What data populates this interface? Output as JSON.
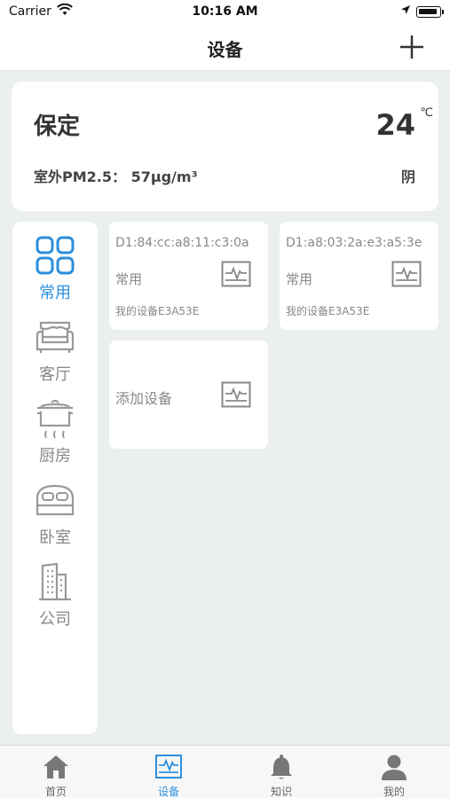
{
  "status_bar": {
    "carrier": "Carrier",
    "time": "10:16 AM"
  },
  "nav": {
    "title": "设备",
    "add_icon": "plus-icon"
  },
  "weather": {
    "city": "保定",
    "temperature": "24",
    "unit": "℃",
    "pm25": "室外PM2.5： 57μg/m³",
    "condition": "阴"
  },
  "rooms": [
    {
      "label": "常用",
      "icon": "grid-icon",
      "active": true
    },
    {
      "label": "客厅",
      "icon": "sofa-icon",
      "active": false
    },
    {
      "label": "厨房",
      "icon": "pot-icon",
      "active": false
    },
    {
      "label": "卧室",
      "icon": "bed-icon",
      "active": false
    },
    {
      "label": "公司",
      "icon": "building-icon",
      "active": false
    }
  ],
  "devices": [
    {
      "mac": "D1:84:cc:a8:11:c3:0a",
      "room": "常用",
      "name": "我的设备E3A53E",
      "icon": "monitor-icon"
    },
    {
      "mac": "D1:a8:03:2a:e3:a5:3e",
      "room": "常用",
      "name": "我的设备E3A53E",
      "icon": "monitor-icon"
    }
  ],
  "add_device": {
    "label": "添加设备",
    "icon": "monitor-icon"
  },
  "tabs": [
    {
      "label": "首页",
      "icon": "home-icon",
      "active": false
    },
    {
      "label": "设备",
      "icon": "device-icon",
      "active": true
    },
    {
      "label": "知识",
      "icon": "bell-icon",
      "active": false
    },
    {
      "label": "我的",
      "icon": "user-icon",
      "active": false
    }
  ],
  "colors": {
    "accent": "#2b8fdd",
    "background": "#eceff0",
    "inactive": "#888888"
  }
}
